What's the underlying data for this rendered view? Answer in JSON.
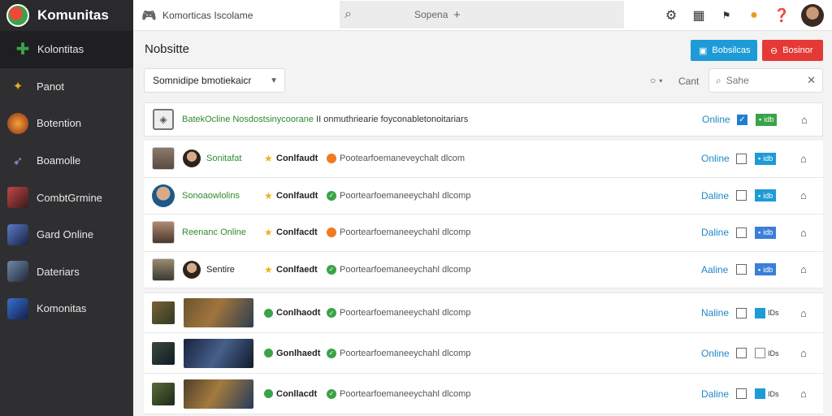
{
  "app": {
    "name": "Komunitas"
  },
  "sidebar": {
    "items": [
      {
        "label": "Kolontitas",
        "active": true,
        "icon": "plus-icon",
        "color": "#3aa348"
      },
      {
        "label": "Panot",
        "icon": "wand-icon",
        "color": "#e0b020"
      },
      {
        "label": "Botention",
        "icon": "game-icon",
        "color": "#e86a2a"
      },
      {
        "label": "Boamolle",
        "icon": "arrow-icon",
        "color": "#5a7ad8"
      },
      {
        "label": "CombtGrmine",
        "icon": "game-icon",
        "color": "#b04040"
      },
      {
        "label": "Gard Online",
        "icon": "game-icon",
        "color": "#4060a0"
      },
      {
        "label": "Dateriars",
        "icon": "game-icon",
        "color": "#506080"
      },
      {
        "label": "Komonitas",
        "icon": "game-icon",
        "color": "#3060b0"
      }
    ]
  },
  "topbar": {
    "title": "Komorticas Iscolame",
    "search_text": "Sopena",
    "search_plus": "+"
  },
  "page": {
    "title": "Nobsitte",
    "btn_primary": "Bobsilcas",
    "btn_danger": "Bosinor",
    "select_value": "Somnidipe bmotiekaicr",
    "filter_label": "Cant",
    "search_placeholder": "Sahe"
  },
  "header_row": {
    "green_text": "BatekOcline Nosdostsinycoorane",
    "rest_text": " II  onmuthriearie foyconabletonoitariars",
    "status": "Online",
    "tag": "idb"
  },
  "user_rows": [
    {
      "avatar_style": "double",
      "name": "Sonitafat",
      "name_color": "green",
      "community": "Conlfaudt",
      "dot": "orange",
      "desc": "Pootearfoemaneveychalt dlcom",
      "status": "Online",
      "tag": "idb",
      "tag_color": "blue"
    },
    {
      "avatar_style": "round",
      "name": "Sonoaowlolins",
      "name_color": "green",
      "community": "Conlfaudt",
      "dot": "green",
      "desc": "Poortearfoemaneeychahl dlcomp",
      "status": "Daline",
      "tag": "idb",
      "tag_color": "blue"
    },
    {
      "avatar_style": "single",
      "name": "Reenanc Online",
      "name_color": "green",
      "community": "Conlfacdt",
      "dot": "orange",
      "desc": "Poortearfoemaneeychahl dlcomp",
      "status": "Daline",
      "tag": "idb",
      "tag_color": "blue"
    },
    {
      "avatar_style": "double",
      "name": "Sentire",
      "name_color": "black",
      "community": "Conlfaedt",
      "dot": "green",
      "desc": "Poortearfoemaneeychahl dlcomp",
      "status": "Aaline",
      "tag": "idb",
      "tag_color": "blue"
    }
  ],
  "game_rows": [
    {
      "community": "Conlhaodt",
      "desc": "Poortearfoemaneeychahl dlcomp",
      "status": "Naline",
      "tag": "IDs",
      "checked_square": true
    },
    {
      "community": "Gonlhaedt",
      "desc": "Poortearfoemaneeychahl dlcomp",
      "status": "Online",
      "tag": "IDs",
      "checked_square": false
    },
    {
      "community": "Conllacdt",
      "desc": "Poortearfoemaneeychahl dlcomp",
      "status": "Daline",
      "tag": "IDs",
      "checked_square": true
    }
  ],
  "colors": {
    "accent": "#1e9bd7",
    "danger": "#e53935",
    "green": "#3aa348",
    "sidebar": "#2f2f31"
  }
}
